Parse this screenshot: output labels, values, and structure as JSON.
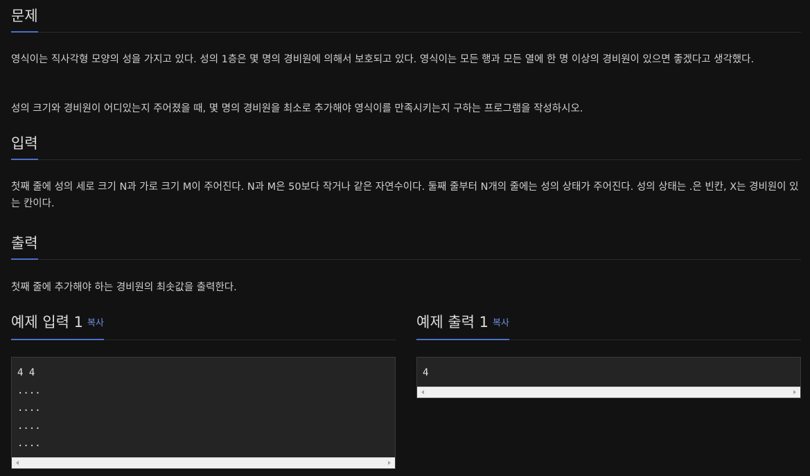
{
  "problem": {
    "title": "문제",
    "paragraph1": "영식이는 직사각형 모양의 성을 가지고 있다. 성의 1층은 몇 명의 경비원에 의해서 보호되고 있다. 영식이는 모든 행과 모든 열에 한 명 이상의 경비원이 있으면 좋겠다고 생각했다.",
    "paragraph2": "성의 크기와 경비원이 어디있는지 주어졌을 때, 몇 명의 경비원을 최소로 추가해야 영식이를 만족시키는지 구하는 프로그램을 작성하시오."
  },
  "input": {
    "title": "입력",
    "paragraph": "첫째 줄에 성의 세로 크기 N과 가로 크기 M이 주어진다. N과 M은 50보다 작거나 같은 자연수이다. 둘째 줄부터 N개의 줄에는 성의 상태가 주어진다. 성의 상태는 .은 빈칸, X는 경비원이 있는 칸이다."
  },
  "output": {
    "title": "출력",
    "paragraph": "첫째 줄에 추가해야 하는 경비원의 최솟값을 출력한다."
  },
  "sample_input": {
    "title": "예제 입력 1",
    "copy_label": "복사",
    "content": "4 4\n....\n....\n....\n...."
  },
  "sample_output": {
    "title": "예제 출력 1",
    "copy_label": "복사",
    "content": "4"
  },
  "colors": {
    "background": "#121213",
    "accent": "#4a70c9",
    "link": "#6f8fe0"
  }
}
